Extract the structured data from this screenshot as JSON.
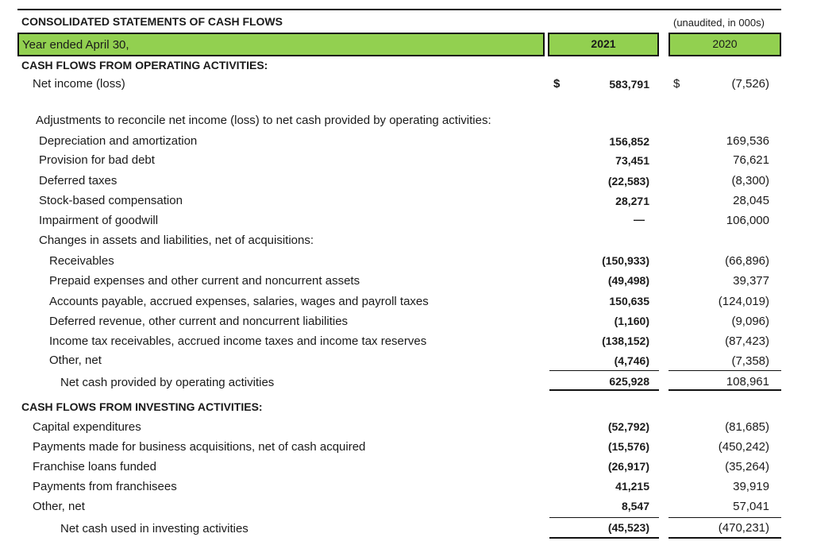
{
  "statement": {
    "title": "CONSOLIDATED STATEMENTS OF CASH FLOWS",
    "note": "(unaudited, in 000s)",
    "year_label": "Year ended April 30,",
    "years": [
      "2021",
      "2020"
    ]
  },
  "operating": {
    "header": "CASH FLOWS FROM OPERATING ACTIVITIES:",
    "net_income": {
      "label": "Net income (loss)",
      "cur1": "$",
      "v2021": "583,791",
      "cur2": "$",
      "v2020": "(7,526)"
    },
    "adjustments_label": "Adjustments to reconcile net income (loss) to net cash provided by operating activities:",
    "adjustments": [
      {
        "label": "Depreciation and amortization",
        "v2021": "156,852",
        "v2020": "169,536"
      },
      {
        "label": "Provision for bad debt",
        "v2021": "73,451",
        "v2020": "76,621"
      },
      {
        "label": "Deferred taxes",
        "v2021": "(22,583)",
        "v2020": "(8,300)"
      },
      {
        "label": "Stock-based compensation",
        "v2021": "28,271",
        "v2020": "28,045"
      },
      {
        "label": "Impairment of goodwill",
        "v2021": "—",
        "v2020": "106,000"
      }
    ],
    "changes_label": "Changes in assets and liabilities, net of acquisitions:",
    "changes": [
      {
        "label": "Receivables",
        "v2021": "(150,933)",
        "v2020": "(66,896)"
      },
      {
        "label": "Prepaid expenses and other current and noncurrent assets",
        "v2021": "(49,498)",
        "v2020": "39,377"
      },
      {
        "label": "Accounts payable, accrued expenses, salaries, wages and payroll taxes",
        "v2021": "150,635",
        "v2020": "(124,019)"
      },
      {
        "label": "Deferred revenue, other current and noncurrent liabilities",
        "v2021": "(1,160)",
        "v2020": "(9,096)"
      },
      {
        "label": "Income tax receivables, accrued income taxes and income tax reserves",
        "v2021": "(138,152)",
        "v2020": "(87,423)"
      },
      {
        "label": "Other, net",
        "v2021": "(4,746)",
        "v2020": "(7,358)"
      }
    ],
    "total": {
      "label": "Net cash provided by operating activities",
      "v2021": "625,928",
      "v2020": "108,961"
    }
  },
  "investing": {
    "header": "CASH FLOWS FROM INVESTING ACTIVITIES:",
    "items": [
      {
        "label": "Capital expenditures",
        "v2021": "(52,792)",
        "v2020": "(81,685)"
      },
      {
        "label": "Payments made for business acquisitions, net of cash acquired",
        "v2021": "(15,576)",
        "v2020": "(450,242)"
      },
      {
        "label": "Franchise loans funded",
        "v2021": "(26,917)",
        "v2020": "(35,264)"
      },
      {
        "label": "Payments from franchisees",
        "v2021": "41,215",
        "v2020": "39,919"
      },
      {
        "label": "Other, net",
        "v2021": "8,547",
        "v2020": "57,041"
      }
    ],
    "total": {
      "label": "Net cash used in investing activities",
      "v2021": "(45,523)",
      "v2020": "(470,231)"
    }
  }
}
